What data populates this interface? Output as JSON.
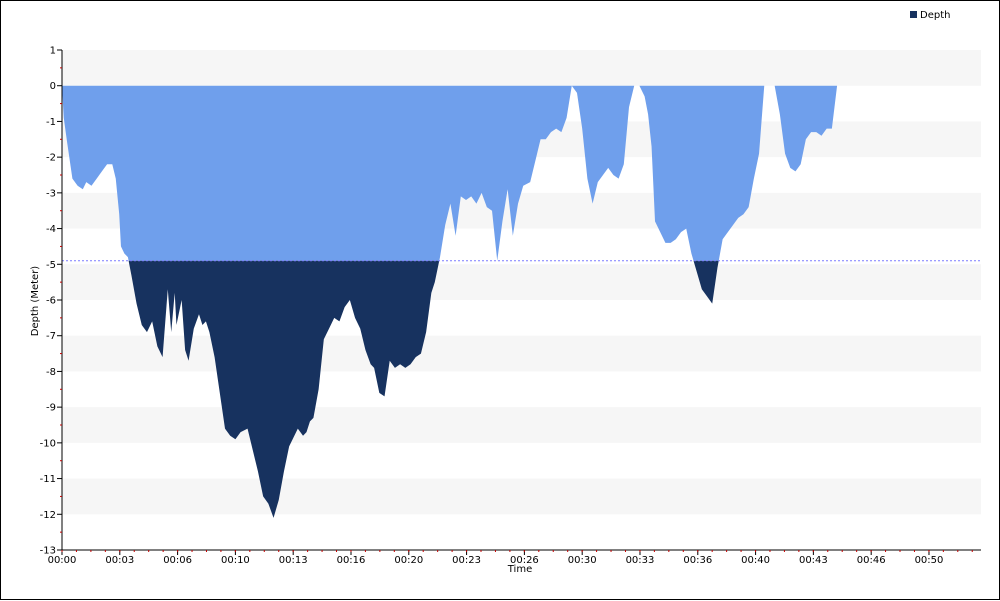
{
  "chart_data": {
    "type": "area",
    "xlabel": "Time",
    "ylabel": "Depth (Meter)",
    "legend": {
      "label": "Depth",
      "position": "top-right"
    },
    "xlim_minutes": [
      0,
      53
    ],
    "ylim": [
      -13,
      1
    ],
    "y_ticks": [
      1,
      0,
      -1,
      -2,
      -3,
      -4,
      -5,
      -6,
      -7,
      -8,
      -9,
      -10,
      -11,
      -12,
      -13
    ],
    "y_tick_labels": [
      "1",
      "0",
      "-1",
      "-2",
      "-3",
      "-4",
      "-5",
      "-6",
      "-7",
      "-8",
      "-9",
      "-10",
      "-11",
      "-12",
      "-13"
    ],
    "x_ticks_minutes": [
      0,
      3.333,
      6.667,
      10,
      13.333,
      16.667,
      20,
      23.333,
      26.667,
      30,
      33.333,
      36.667,
      40,
      43.333,
      46.667,
      50
    ],
    "x_tick_labels": [
      "00:00",
      "00:03",
      "00:06",
      "00:10",
      "00:13",
      "00:16",
      "00:20",
      "00:23",
      "00:26",
      "00:30",
      "00:33",
      "00:36",
      "00:40",
      "00:43",
      "00:46",
      "00:50"
    ],
    "alternating_bands": true,
    "threshold_line": {
      "value": -4.9,
      "style": "dotted",
      "color": "#7b7bff"
    },
    "colors": {
      "shallow": "#6f9fec",
      "deep": "#17325f",
      "band": "#f6f6f6",
      "axis": "#000000",
      "minor_tick": "#c00000"
    },
    "series": [
      {
        "name": "Depth",
        "x_minutes": [
          0,
          0.1,
          0.3,
          0.6,
          0.9,
          1.2,
          1.4,
          1.7,
          2,
          2.3,
          2.6,
          2.9,
          3.1,
          3.3,
          3.4,
          3.6,
          3.8,
          4,
          4.3,
          4.6,
          4.9,
          5.2,
          5.5,
          5.8,
          6.1,
          6.3,
          6.5,
          6.6,
          6.9,
          7.1,
          7.3,
          7.6,
          7.9,
          8.1,
          8.3,
          8.5,
          8.8,
          9.1,
          9.4,
          9.7,
          10,
          10.3,
          10.7,
          11,
          11.3,
          11.6,
          11.9,
          12.2,
          12.5,
          12.8,
          13.1,
          13.4,
          13.6,
          13.9,
          14.1,
          14.3,
          14.5,
          14.8,
          15.1,
          15.4,
          15.7,
          16,
          16.3,
          16.6,
          16.9,
          17.2,
          17.5,
          17.8,
          18,
          18.3,
          18.6,
          18.9,
          19.2,
          19.5,
          19.8,
          20.1,
          20.4,
          20.7,
          21,
          21.3,
          21.5,
          21.8,
          22.1,
          22.4,
          22.7,
          23,
          23.3,
          23.6,
          23.9,
          24.2,
          24.5,
          24.8,
          25.1,
          25.4,
          25.7,
          26,
          26.3,
          26.6,
          27,
          27.3,
          27.6,
          27.9,
          28.2,
          28.5,
          28.8,
          29.1,
          29.4,
          29.7,
          30,
          30.3,
          30.6,
          30.9,
          31.2,
          31.5,
          31.8,
          32.1,
          32.4,
          32.7,
          33,
          33.3,
          33.6,
          33.8,
          34,
          34.2,
          34.5,
          34.8,
          35.1,
          35.4,
          35.7,
          36,
          36.3,
          36.6,
          36.9,
          37.2,
          37.5,
          37.8,
          38.1,
          38.4,
          38.7,
          39,
          39.3,
          39.6,
          39.9,
          40.2,
          40.5,
          40.8,
          41.1,
          41.4,
          41.7,
          42,
          42.3,
          42.6,
          42.9,
          43.2,
          43.5,
          43.8,
          44.1,
          44.4,
          44.7,
          45,
          45.3,
          45.6,
          45.9,
          46.2,
          46.5,
          46.8,
          47.1,
          47.4,
          47.7,
          48,
          48.3,
          48.6,
          48.9,
          49.2,
          49.5,
          49.8,
          50.1,
          50.4,
          50.7,
          50.9
        ],
        "y": [
          0,
          -0.9,
          -1.6,
          -2.6,
          -2.8,
          -2.9,
          -2.7,
          -2.8,
          -2.6,
          -2.4,
          -2.2,
          -2.2,
          -2.6,
          -3.6,
          -4.5,
          -4.7,
          -4.8,
          -5.3,
          -6.1,
          -6.7,
          -6.9,
          -6.6,
          -7.3,
          -7.6,
          -5.7,
          -6.9,
          -5.8,
          -6.7,
          -6.0,
          -7.4,
          -7.7,
          -6.8,
          -6.4,
          -6.7,
          -6.6,
          -6.9,
          -7.6,
          -8.6,
          -9.6,
          -9.8,
          -9.9,
          -9.7,
          -9.6,
          -10.2,
          -10.8,
          -11.5,
          -11.7,
          -12.1,
          -11.6,
          -10.8,
          -10.1,
          -9.8,
          -9.6,
          -9.8,
          -9.7,
          -9.4,
          -9.3,
          -8.5,
          -7.1,
          -6.8,
          -6.5,
          -6.6,
          -6.2,
          -6.0,
          -6.5,
          -6.8,
          -7.4,
          -7.8,
          -7.9,
          -8.6,
          -8.7,
          -7.7,
          -7.9,
          -7.8,
          -7.9,
          -7.8,
          -7.6,
          -7.5,
          -6.9,
          -5.8,
          -5.5,
          -4.8,
          -3.9,
          -3.3,
          -4.2,
          -3.1,
          -3.2,
          -3.1,
          -3.3,
          -3.0,
          -3.4,
          -3.5,
          -4.9,
          -3.8,
          -2.9,
          -4.2,
          -3.3,
          -2.8,
          -2.7,
          -2.1,
          -1.5,
          -1.5,
          -1.3,
          -1.2,
          -1.3,
          -0.9,
          0,
          -0.2,
          -1.2,
          -2.6,
          -3.3,
          -2.7,
          -2.5,
          -2.3,
          -2.5,
          -2.6,
          -2.2,
          -0.6,
          0,
          0,
          -0.3,
          -0.8,
          -1.7,
          -3.8,
          -4.1,
          -4.4,
          -4.4,
          -4.3,
          -4.1,
          -4.0,
          -4.7,
          -5.2,
          -5.7,
          -5.9,
          -6.1,
          -5.1,
          -4.3,
          -4.1,
          -3.9,
          -3.7,
          -3.6,
          -3.4,
          -2.6,
          -1.9,
          0,
          0,
          0,
          -0.8,
          -1.9,
          -2.3,
          -2.4,
          -2.2,
          -1.5,
          -1.3,
          -1.3,
          -1.4,
          -1.2,
          -1.2,
          0,
          0,
          0,
          0,
          0,
          0,
          0,
          0,
          0,
          0,
          0,
          0,
          0,
          0,
          0,
          0,
          0,
          0,
          0,
          0,
          0,
          0
        ]
      }
    ]
  }
}
